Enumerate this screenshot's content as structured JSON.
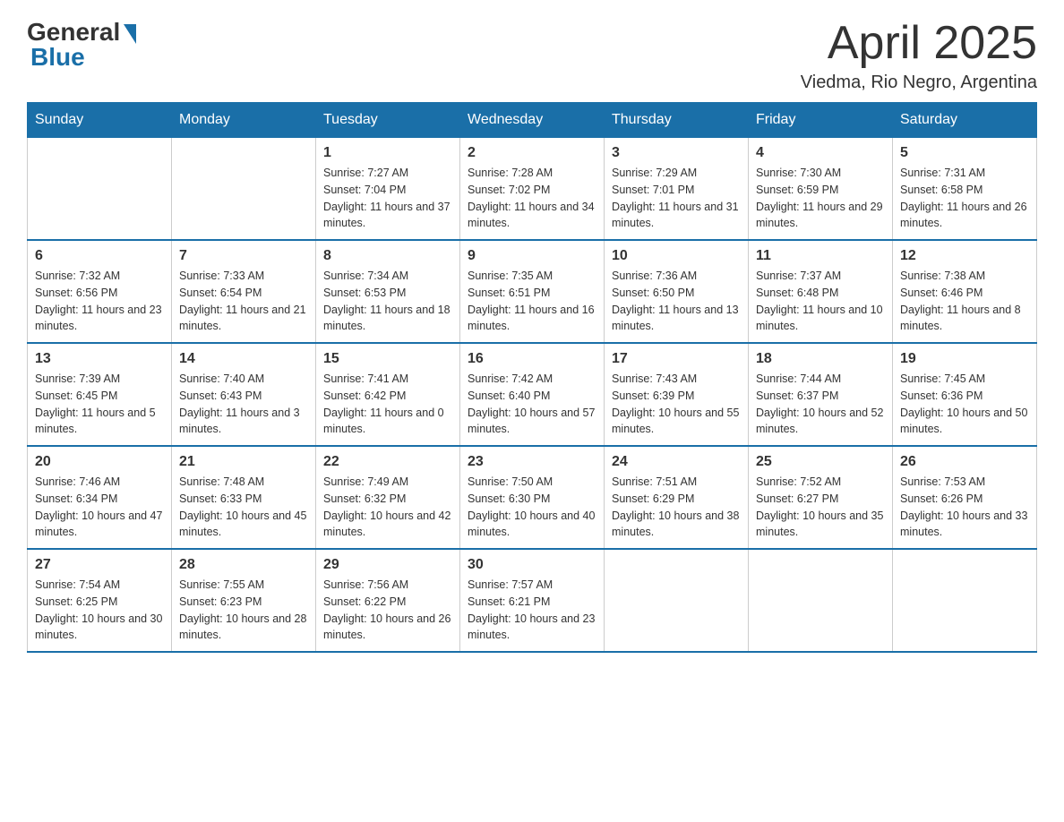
{
  "header": {
    "logo_general": "General",
    "logo_blue": "Blue",
    "month_title": "April 2025",
    "location": "Viedma, Rio Negro, Argentina"
  },
  "weekdays": [
    "Sunday",
    "Monday",
    "Tuesday",
    "Wednesday",
    "Thursday",
    "Friday",
    "Saturday"
  ],
  "weeks": [
    [
      {
        "day": "",
        "sunrise": "",
        "sunset": "",
        "daylight": ""
      },
      {
        "day": "",
        "sunrise": "",
        "sunset": "",
        "daylight": ""
      },
      {
        "day": "1",
        "sunrise": "Sunrise: 7:27 AM",
        "sunset": "Sunset: 7:04 PM",
        "daylight": "Daylight: 11 hours and 37 minutes."
      },
      {
        "day": "2",
        "sunrise": "Sunrise: 7:28 AM",
        "sunset": "Sunset: 7:02 PM",
        "daylight": "Daylight: 11 hours and 34 minutes."
      },
      {
        "day": "3",
        "sunrise": "Sunrise: 7:29 AM",
        "sunset": "Sunset: 7:01 PM",
        "daylight": "Daylight: 11 hours and 31 minutes."
      },
      {
        "day": "4",
        "sunrise": "Sunrise: 7:30 AM",
        "sunset": "Sunset: 6:59 PM",
        "daylight": "Daylight: 11 hours and 29 minutes."
      },
      {
        "day": "5",
        "sunrise": "Sunrise: 7:31 AM",
        "sunset": "Sunset: 6:58 PM",
        "daylight": "Daylight: 11 hours and 26 minutes."
      }
    ],
    [
      {
        "day": "6",
        "sunrise": "Sunrise: 7:32 AM",
        "sunset": "Sunset: 6:56 PM",
        "daylight": "Daylight: 11 hours and 23 minutes."
      },
      {
        "day": "7",
        "sunrise": "Sunrise: 7:33 AM",
        "sunset": "Sunset: 6:54 PM",
        "daylight": "Daylight: 11 hours and 21 minutes."
      },
      {
        "day": "8",
        "sunrise": "Sunrise: 7:34 AM",
        "sunset": "Sunset: 6:53 PM",
        "daylight": "Daylight: 11 hours and 18 minutes."
      },
      {
        "day": "9",
        "sunrise": "Sunrise: 7:35 AM",
        "sunset": "Sunset: 6:51 PM",
        "daylight": "Daylight: 11 hours and 16 minutes."
      },
      {
        "day": "10",
        "sunrise": "Sunrise: 7:36 AM",
        "sunset": "Sunset: 6:50 PM",
        "daylight": "Daylight: 11 hours and 13 minutes."
      },
      {
        "day": "11",
        "sunrise": "Sunrise: 7:37 AM",
        "sunset": "Sunset: 6:48 PM",
        "daylight": "Daylight: 11 hours and 10 minutes."
      },
      {
        "day": "12",
        "sunrise": "Sunrise: 7:38 AM",
        "sunset": "Sunset: 6:46 PM",
        "daylight": "Daylight: 11 hours and 8 minutes."
      }
    ],
    [
      {
        "day": "13",
        "sunrise": "Sunrise: 7:39 AM",
        "sunset": "Sunset: 6:45 PM",
        "daylight": "Daylight: 11 hours and 5 minutes."
      },
      {
        "day": "14",
        "sunrise": "Sunrise: 7:40 AM",
        "sunset": "Sunset: 6:43 PM",
        "daylight": "Daylight: 11 hours and 3 minutes."
      },
      {
        "day": "15",
        "sunrise": "Sunrise: 7:41 AM",
        "sunset": "Sunset: 6:42 PM",
        "daylight": "Daylight: 11 hours and 0 minutes."
      },
      {
        "day": "16",
        "sunrise": "Sunrise: 7:42 AM",
        "sunset": "Sunset: 6:40 PM",
        "daylight": "Daylight: 10 hours and 57 minutes."
      },
      {
        "day": "17",
        "sunrise": "Sunrise: 7:43 AM",
        "sunset": "Sunset: 6:39 PM",
        "daylight": "Daylight: 10 hours and 55 minutes."
      },
      {
        "day": "18",
        "sunrise": "Sunrise: 7:44 AM",
        "sunset": "Sunset: 6:37 PM",
        "daylight": "Daylight: 10 hours and 52 minutes."
      },
      {
        "day": "19",
        "sunrise": "Sunrise: 7:45 AM",
        "sunset": "Sunset: 6:36 PM",
        "daylight": "Daylight: 10 hours and 50 minutes."
      }
    ],
    [
      {
        "day": "20",
        "sunrise": "Sunrise: 7:46 AM",
        "sunset": "Sunset: 6:34 PM",
        "daylight": "Daylight: 10 hours and 47 minutes."
      },
      {
        "day": "21",
        "sunrise": "Sunrise: 7:48 AM",
        "sunset": "Sunset: 6:33 PM",
        "daylight": "Daylight: 10 hours and 45 minutes."
      },
      {
        "day": "22",
        "sunrise": "Sunrise: 7:49 AM",
        "sunset": "Sunset: 6:32 PM",
        "daylight": "Daylight: 10 hours and 42 minutes."
      },
      {
        "day": "23",
        "sunrise": "Sunrise: 7:50 AM",
        "sunset": "Sunset: 6:30 PM",
        "daylight": "Daylight: 10 hours and 40 minutes."
      },
      {
        "day": "24",
        "sunrise": "Sunrise: 7:51 AM",
        "sunset": "Sunset: 6:29 PM",
        "daylight": "Daylight: 10 hours and 38 minutes."
      },
      {
        "day": "25",
        "sunrise": "Sunrise: 7:52 AM",
        "sunset": "Sunset: 6:27 PM",
        "daylight": "Daylight: 10 hours and 35 minutes."
      },
      {
        "day": "26",
        "sunrise": "Sunrise: 7:53 AM",
        "sunset": "Sunset: 6:26 PM",
        "daylight": "Daylight: 10 hours and 33 minutes."
      }
    ],
    [
      {
        "day": "27",
        "sunrise": "Sunrise: 7:54 AM",
        "sunset": "Sunset: 6:25 PM",
        "daylight": "Daylight: 10 hours and 30 minutes."
      },
      {
        "day": "28",
        "sunrise": "Sunrise: 7:55 AM",
        "sunset": "Sunset: 6:23 PM",
        "daylight": "Daylight: 10 hours and 28 minutes."
      },
      {
        "day": "29",
        "sunrise": "Sunrise: 7:56 AM",
        "sunset": "Sunset: 6:22 PM",
        "daylight": "Daylight: 10 hours and 26 minutes."
      },
      {
        "day": "30",
        "sunrise": "Sunrise: 7:57 AM",
        "sunset": "Sunset: 6:21 PM",
        "daylight": "Daylight: 10 hours and 23 minutes."
      },
      {
        "day": "",
        "sunrise": "",
        "sunset": "",
        "daylight": ""
      },
      {
        "day": "",
        "sunrise": "",
        "sunset": "",
        "daylight": ""
      },
      {
        "day": "",
        "sunrise": "",
        "sunset": "",
        "daylight": ""
      }
    ]
  ]
}
